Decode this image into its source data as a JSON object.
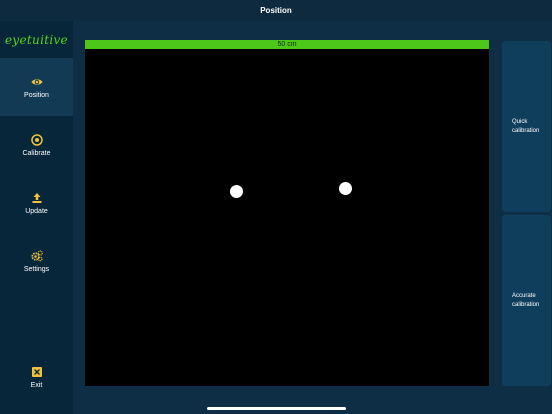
{
  "window": {
    "title": "Position"
  },
  "sidebar": {
    "logo_text": "eyetuitive",
    "items": [
      {
        "label": "Position",
        "icon": "eye-icon"
      },
      {
        "label": "Calibrate",
        "icon": "target-icon"
      },
      {
        "label": "Update",
        "icon": "upload-icon"
      },
      {
        "label": "Settings",
        "icon": "gears-icon"
      },
      {
        "label": "Exit",
        "icon": "close-box-icon"
      }
    ],
    "active_item": "Position"
  },
  "main": {
    "distance_label": "50 cm",
    "tracked_eyes": [
      "left-eye",
      "right-eye"
    ]
  },
  "actions": {
    "quick_calibration": "Quick calibration",
    "accurate_calibration": "Accurate calibration"
  },
  "colors": {
    "accent_yellow": "#f0c23b",
    "brand_green": "#55d41e",
    "distance_bar_green": "#4dc81a",
    "sidebar_bg": "#07263a",
    "active_item_bg": "#123a55",
    "button_bg": "#0f3d5c"
  }
}
